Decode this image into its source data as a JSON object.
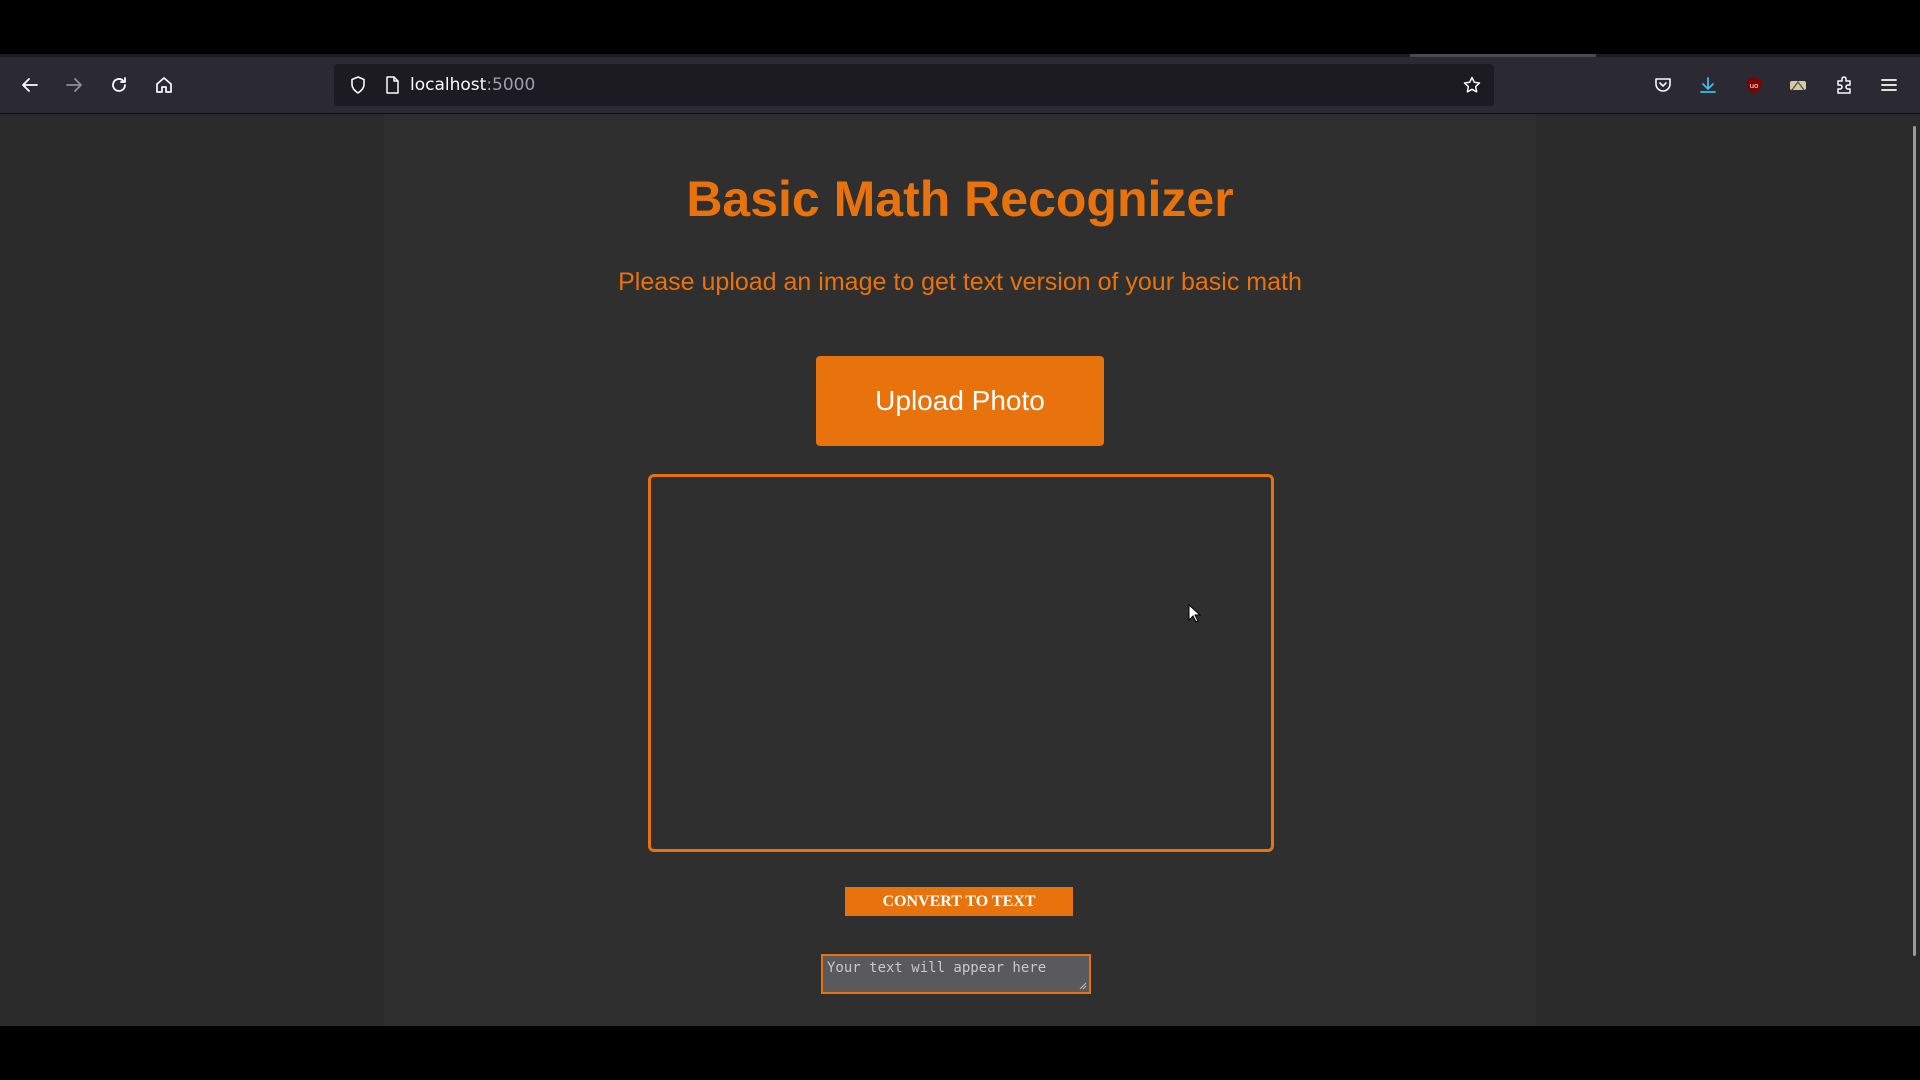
{
  "browser": {
    "url_host": "localhost",
    "url_port": ":5000",
    "icons": {
      "back": "back-arrow-icon",
      "forward": "forward-arrow-icon",
      "reload": "reload-icon",
      "home": "home-icon",
      "shield": "shield-icon",
      "page": "page-icon",
      "bookmark": "star-icon",
      "pocket": "pocket-icon",
      "downloads": "download-icon",
      "ublock": "ublock-icon",
      "extension_1": "extension-icon",
      "extensions": "puzzle-icon",
      "menu": "hamburger-menu-icon"
    }
  },
  "page": {
    "title": "Basic Math Recognizer",
    "subtitle": "Please upload an image to get text version of your basic math",
    "upload_button": "Upload Photo",
    "convert_button": "CONVERT TO TEXT",
    "output_placeholder": "Your text will appear here",
    "accent_color": "#e8720c",
    "background_color": "#2f2f2f"
  }
}
